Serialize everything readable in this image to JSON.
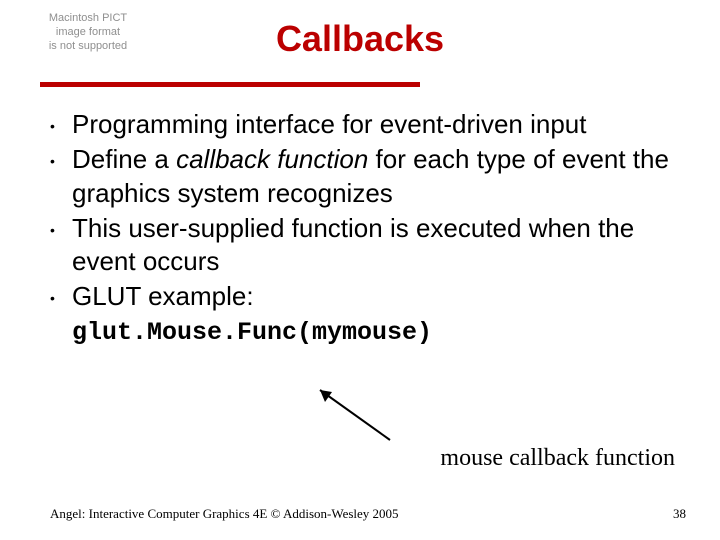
{
  "placeholder": {
    "line1": "Macintosh PICT",
    "line2": "image format",
    "line3": "is not supported"
  },
  "title": "Callbacks",
  "bullets": [
    {
      "pre": "Programming interface for event-driven input"
    },
    {
      "pre": "Define a ",
      "em": "callback function",
      "post": " for each type of event the graphics system recognizes"
    },
    {
      "pre": "This user-supplied function is executed when the event occurs"
    },
    {
      "pre": "GLUT example:",
      "code": "glut.Mouse.Func(mymouse)"
    }
  ],
  "caption": "mouse callback function",
  "footer": {
    "left": "Angel: Interactive Computer Graphics 4E © Addison-Wesley 2005",
    "right": "38"
  },
  "colors": {
    "accent": "#bb0000"
  }
}
